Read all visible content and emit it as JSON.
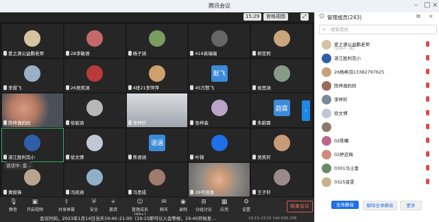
{
  "window": {
    "title": "腾讯会议"
  },
  "toolbar_top": {
    "time": "15:29",
    "view_label": "宫格视图"
  },
  "tiles": [
    {
      "label": "爱之源公益鹏老师",
      "avatar_color": "#d7c3a0",
      "kind": "avatar"
    },
    {
      "label": "28李敏语",
      "avatar_color": "#c46a6a",
      "kind": "avatar"
    },
    {
      "label": "杨子涵",
      "avatar_color": "#7a9b5e",
      "kind": "avatar"
    },
    {
      "label": "416袁瑞瑞",
      "avatar_color": "#666666",
      "kind": "avatar"
    },
    {
      "label": "柳亚熙",
      "avatar_color": "#caa47a",
      "kind": "avatar"
    },
    {
      "label": "李煜飞",
      "avatar_color": "#9ab0c6",
      "kind": "avatar"
    },
    {
      "label": "26吴奕涵",
      "avatar_color": "#b83a3a",
      "kind": "avatar"
    },
    {
      "label": "4班21李萍萍",
      "avatar_color": "#d0a06a",
      "kind": "avatar"
    },
    {
      "label": "45万默飞",
      "avatar_color": "#3c8bd9",
      "kind": "text",
      "text": "默飞"
    },
    {
      "label": "侯思涵",
      "avatar_color": "#8a9a8a",
      "kind": "avatar"
    },
    {
      "label": "陈梓逸妈妈",
      "kind": "video",
      "style": "skin"
    },
    {
      "label": "徐宸涵",
      "avatar_color": "#b7b7b7",
      "kind": "avatar"
    },
    {
      "label": "李梓轩",
      "kind": "video",
      "style": "light"
    },
    {
      "label": "张梓森",
      "avatar_color": "#b9a4c8",
      "kind": "avatar"
    },
    {
      "label": "朱蔚霖",
      "avatar_color": "#3c8bd9",
      "kind": "text",
      "text": "蔚霖"
    },
    {
      "label": "湛江胜利完小",
      "avatar_color": "#2e5fa8",
      "kind": "avatar",
      "highlight": true
    },
    {
      "label": "徐文博",
      "avatar_color": "#c0c8d4",
      "kind": "avatar"
    },
    {
      "label": "焦语涵",
      "avatar_color": "#3c8bd9",
      "kind": "text",
      "text": "语涵"
    },
    {
      "label": "叶锦",
      "avatar_color": "#1e6fe8",
      "kind": "avatar"
    },
    {
      "label": "吴奕轩",
      "avatar_color": "#c79a7a",
      "kind": "avatar"
    },
    {
      "label": "黄俊锋",
      "avatar_color": "#b8a590",
      "kind": "avatar"
    },
    {
      "label": "冯凯涵",
      "avatar_color": "#8fb0c8",
      "kind": "avatar"
    },
    {
      "label": "马思成",
      "avatar_color": "#a07a6a",
      "kind": "avatar"
    },
    {
      "label": "26号阳逸",
      "kind": "video",
      "style": "room"
    },
    {
      "label": "王子轩",
      "avatar_color": "#9a8a8a",
      "kind": "avatar"
    }
  ],
  "speaking": {
    "label": "说话中: 金..."
  },
  "bottom_toolbar": [
    {
      "label": "静音",
      "icon": "mic-icon",
      "glyph": "🎙"
    },
    {
      "label": "开启视频",
      "icon": "camera-icon",
      "glyph": "▣"
    },
    {
      "label": "共享屏幕",
      "icon": "share-screen-icon",
      "glyph": "⇪"
    },
    {
      "label": "安全",
      "icon": "shield-icon",
      "glyph": "⛨"
    },
    {
      "label": "邀请",
      "icon": "invite-icon",
      "glyph": "+"
    },
    {
      "label": "管理成员(99+)",
      "icon": "members-icon",
      "glyph": "☺"
    },
    {
      "label": "聊天",
      "icon": "chat-icon",
      "glyph": "✉"
    },
    {
      "label": "录制",
      "icon": "record-icon",
      "glyph": "◉"
    },
    {
      "label": "分组讨论",
      "icon": "breakout-icon",
      "glyph": "⊞"
    },
    {
      "label": "应用",
      "icon": "apps-icon",
      "glyph": "▦"
    },
    {
      "label": "设置",
      "icon": "settings-icon",
      "glyph": "⚙"
    }
  ],
  "end_button": "结束会议",
  "notice": {
    "text": "会议时间，2023年1月14日当天19:40–21:00（19:15即可以入会等候，19:40开始发...",
    "time": "19:15-23:15  140.636.258"
  },
  "panel": {
    "title": "管理成员(243)",
    "search_placeholder": "搜索成员",
    "members": [
      {
        "name": "爱之源公益鹏老师",
        "sub": "(主持人, 我)",
        "color": "#d7c3a0",
        "mic": "red"
      },
      {
        "name": "湛江胜利完小",
        "sub": "",
        "color": "#2e5fa8",
        "mic": "red"
      },
      {
        "name": "26杨希羽13382797625",
        "sub": "",
        "color": "#c9a07a",
        "mic": "red"
      },
      {
        "name": "陈梓逸妈妈",
        "sub": "",
        "color": "#9a6a5a",
        "mic": "red"
      },
      {
        "name": "李梓轩",
        "sub": "",
        "color": "#7a8a9a",
        "mic": "red"
      },
      {
        "name": "徐文博",
        "sub": "",
        "color": "#c0c8d4",
        "mic": "red"
      },
      {
        "name": "·",
        "sub": "",
        "color": "#8a7a6a",
        "mic": "red"
      },
      {
        "name": "02陈曦",
        "sub": "",
        "color": "#b86a8a",
        "mic": "red"
      },
      {
        "name": "02婷近梅",
        "sub": "",
        "color": "#d08a7a",
        "mic": "red"
      },
      {
        "name": "0301马士富",
        "sub": "",
        "color": "#6a8a6a",
        "mic": "red"
      },
      {
        "name": "0325普雯",
        "sub": "",
        "color": "#c8b08a",
        "mic": "red"
      }
    ],
    "buttons": {
      "mute_all": "全体静音",
      "unmute_all": "解除全体静音",
      "more": "更多"
    }
  }
}
